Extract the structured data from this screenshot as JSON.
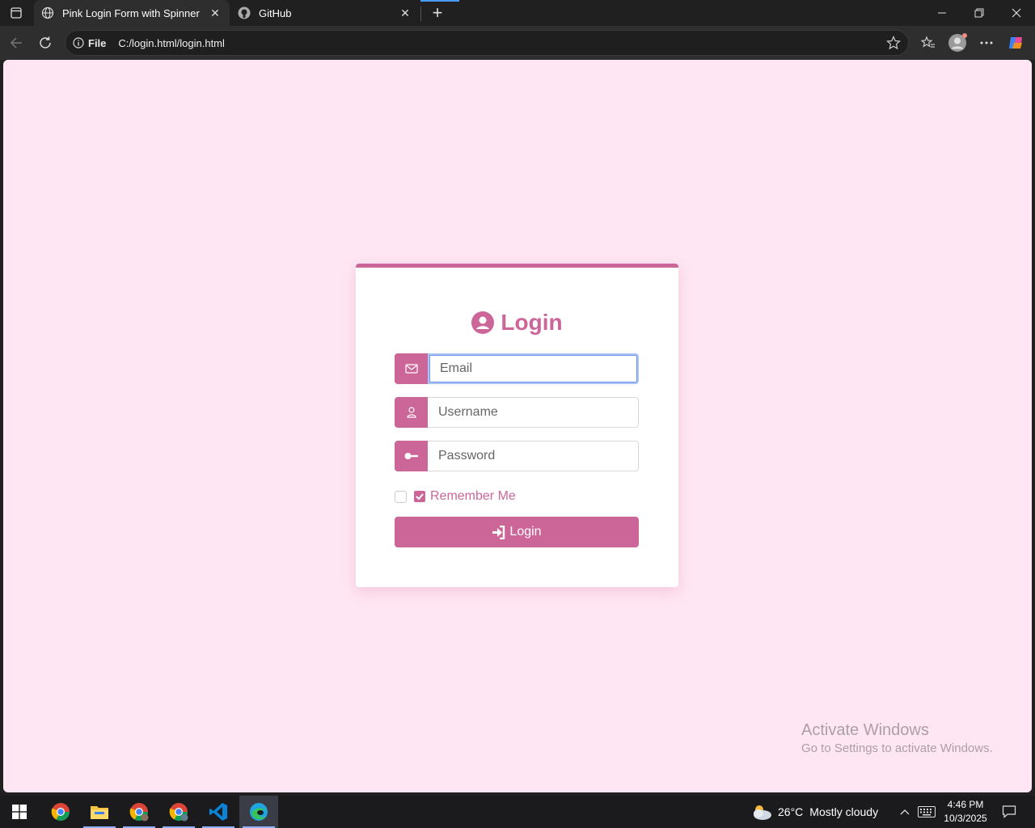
{
  "browser": {
    "tabs": [
      {
        "title": "Pink Login Form with Spinner",
        "active": true,
        "icon": "globe-icon"
      },
      {
        "title": "GitHub",
        "active": false,
        "icon": "github-icon"
      }
    ],
    "address": {
      "scheme": "File",
      "url": "C:/login.html/login.html"
    }
  },
  "form": {
    "title": "Login",
    "email_placeholder": "Email",
    "username_placeholder": "Username",
    "password_placeholder": "Password",
    "remember_label": "Remember Me",
    "remember_checked": true,
    "submit_label": "Login",
    "accent_color": "#cc6699",
    "background_color": "#ffe6f2"
  },
  "watermark": {
    "line1": "Activate Windows",
    "line2": "Go to Settings to activate Windows."
  },
  "taskbar": {
    "apps": [
      "windows-start-icon",
      "chrome-icon",
      "file-explorer-icon",
      "chrome-profile-icon",
      "chrome-profile-icon",
      "vscode-icon",
      "edge-icon"
    ],
    "weather": {
      "temp": "26°C",
      "desc": "Mostly cloudy"
    },
    "time": "4:46 PM",
    "date": "10/3/2025"
  }
}
